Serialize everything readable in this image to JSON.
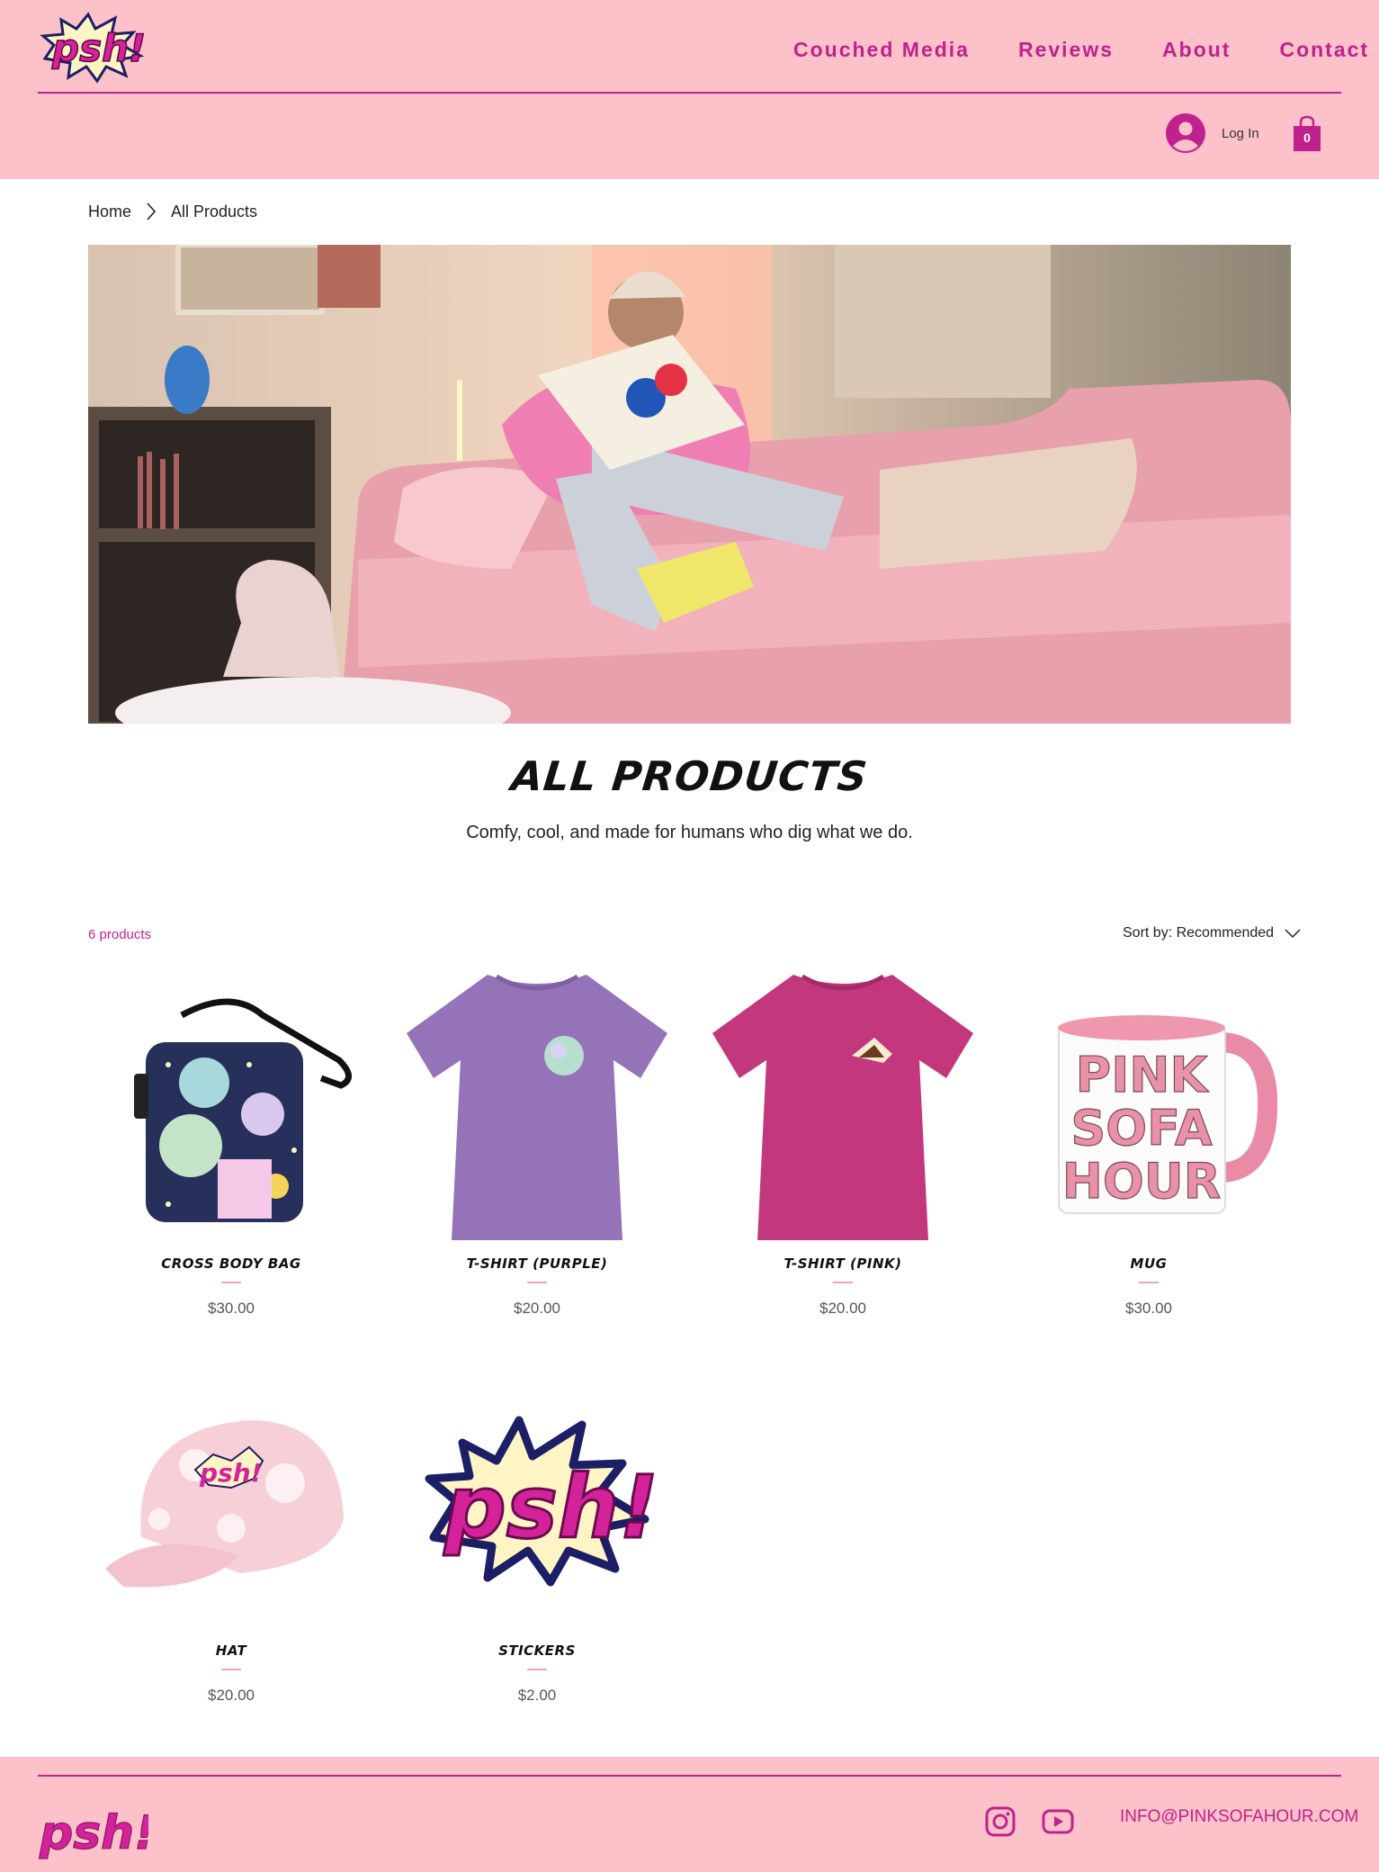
{
  "header": {
    "logo_text": "psh!",
    "nav": [
      "Couched Media",
      "Reviews",
      "About",
      "Contact"
    ],
    "login_label": "Log In",
    "cart_count": "0"
  },
  "breadcrumb": {
    "home": "Home",
    "current": "All Products"
  },
  "page": {
    "title": "ALL PRODUCTS",
    "subtitle": "Comfy, cool, and made for humans who dig what we do."
  },
  "toolbar": {
    "count": "6 products",
    "sort_label": "Sort by: Recommended"
  },
  "products": [
    {
      "name": "CROSS BODY BAG",
      "price": "$30.00",
      "image": "bag-image"
    },
    {
      "name": "T-SHIRT (PURPLE)",
      "price": "$20.00",
      "image": "tshirt-purple-image"
    },
    {
      "name": "T-SHIRT (PINK)",
      "price": "$20.00",
      "image": "tshirt-pink-image"
    },
    {
      "name": "MUG",
      "price": "$30.00",
      "image": "mug-image",
      "mug_text": [
        "PINK",
        "SOFA",
        "HOUR"
      ]
    },
    {
      "name": "HAT",
      "price": "$20.00",
      "image": "hat-image"
    },
    {
      "name": "STICKERS",
      "price": "$2.00",
      "image": "sticker-image"
    }
  ],
  "footer": {
    "email": "INFO@PINKSOFAHOUR.COM",
    "social": [
      "instagram-icon",
      "youtube-icon"
    ]
  },
  "colors": {
    "header_bg": "#fdc2c9",
    "accent": "#c0218d",
    "text": "#1a1a1a"
  }
}
